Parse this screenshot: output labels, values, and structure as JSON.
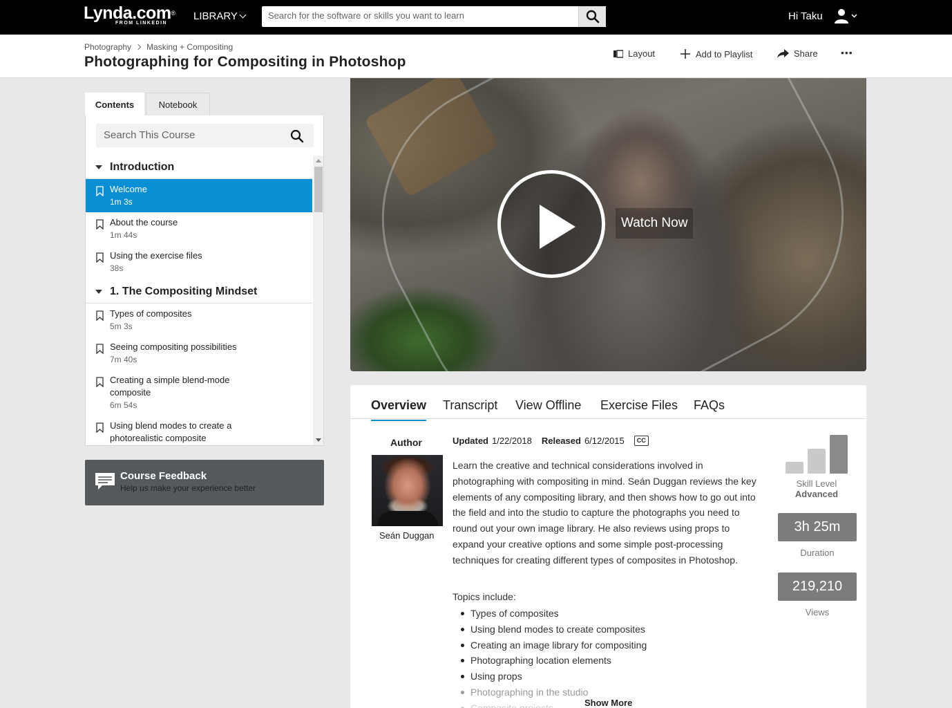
{
  "nav": {
    "logo": "Lynda.com",
    "logo_reg": "®",
    "logo_sub": "FROM LINKEDIN",
    "library": "LIBRARY",
    "search_placeholder": "Search for the software or skills you want to learn",
    "greeting": "Hi Taku"
  },
  "header": {
    "breadcrumbs": [
      "Photography",
      "Masking + Compositing"
    ],
    "title": "Photographing for Compositing in Photoshop",
    "actions": {
      "layout": "Layout",
      "playlist": "Add to Playlist",
      "share": "Share",
      "more": "•••"
    }
  },
  "sidebar": {
    "tabs": [
      "Contents",
      "Notebook"
    ],
    "search_placeholder": "Search This Course",
    "chapters": [
      {
        "title": "Introduction",
        "items": [
          {
            "title": "Welcome",
            "duration": "1m 3s"
          },
          {
            "title": "About the course",
            "duration": "1m 44s"
          },
          {
            "title": "Using the exercise files",
            "duration": "38s"
          }
        ]
      },
      {
        "title": "1. The Compositing Mindset",
        "items": [
          {
            "title": "Types of composites",
            "duration": "5m 3s"
          },
          {
            "title": "Seeing compositing possibilities",
            "duration": "7m 40s"
          },
          {
            "title_line1": "Creating a simple blend-mode",
            "title_line2": "composite",
            "duration": "6m 54s"
          },
          {
            "title_line1": "Using blend modes to create a",
            "title_line2": "photorealistic composite"
          }
        ]
      }
    ],
    "feedback": {
      "title": "Course Feedback",
      "subtitle": "Help us make your experience better"
    }
  },
  "video": {
    "watch_label": "Watch Now"
  },
  "content": {
    "tabs": [
      "Overview",
      "Transcript",
      "View Offline",
      "Exercise Files",
      "FAQs"
    ],
    "author_heading": "Author",
    "author_name": "Seán Duggan",
    "updated_label": "Updated",
    "updated_value": "1/22/2018",
    "released_label": "Released",
    "released_value": "6/12/2015",
    "cc": "CC",
    "description": "Learn the creative and technical considerations involved in photographing with compositing in mind. Seán Duggan reviews the key elements of any compositing library, and then shows how to go out into the field and into the studio to capture the photographs you need to round out your own image library. He also reviews using props to expand your creative options and some simple post-processing techniques for creating different types of composites in Photoshop.",
    "topics_heading": "Topics include:",
    "topics": [
      "Types of composites",
      "Using blend modes to create composites",
      "Creating an image library for compositing",
      "Photographing location elements",
      "Using props",
      "Photographing in the studio",
      "Composite projects"
    ],
    "show_more": "Show More",
    "skill_label": "Skill Level",
    "skill_value": "Advanced",
    "skill_level": 3,
    "duration": "3h 25m",
    "duration_label": "Duration",
    "views": "219,210",
    "views_label": "Views"
  },
  "colors": {
    "accent": "#0b8fd4",
    "nav_bg": "#000000",
    "stat_bg": "#7c7c7c"
  }
}
